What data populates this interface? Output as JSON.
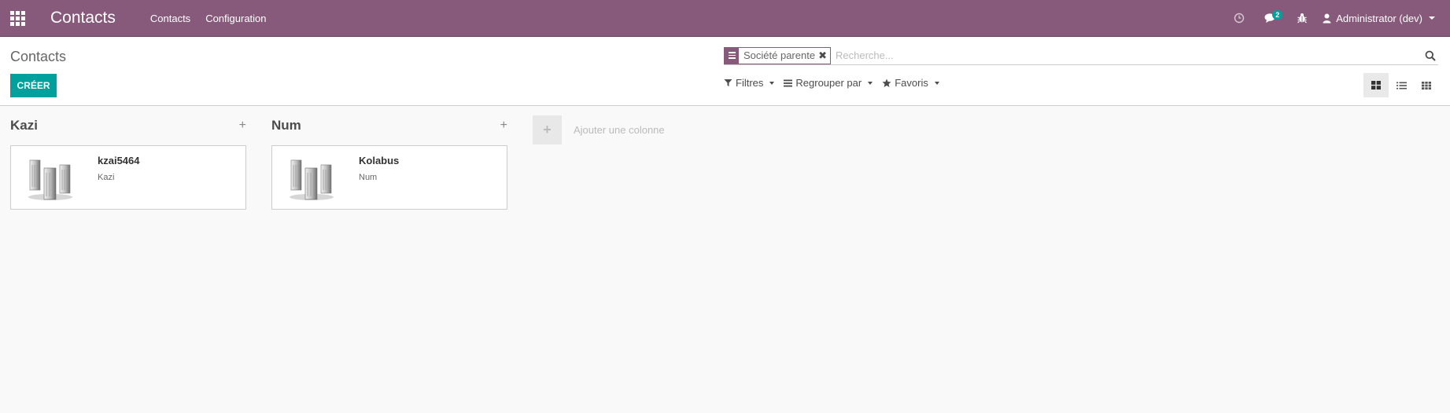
{
  "navbar": {
    "brand": "Contacts",
    "menu": [
      "Contacts",
      "Configuration"
    ],
    "messages_badge": "2",
    "user_label": "Administrator (dev)",
    "colors": {
      "bar": "#875a7b",
      "badge": "#00a09d"
    },
    "icons": [
      "apps-grid-icon",
      "clock-icon",
      "chat-icon",
      "bug-icon",
      "user-icon"
    ]
  },
  "control_panel": {
    "breadcrumb": "Contacts",
    "create_label": "CRÉER",
    "search": {
      "facet": "Société parente",
      "placeholder": "Recherche..."
    },
    "filters": {
      "filters_label": "Filtres",
      "groupby_label": "Regrouper par",
      "favorites_label": "Favoris"
    },
    "views": [
      "kanban-view-icon",
      "list-view-icon",
      "grid-view-icon"
    ]
  },
  "kanban": {
    "columns": [
      {
        "title": "Kazi",
        "cards": [
          {
            "name": "kzai5464",
            "company": "Kazi"
          }
        ]
      },
      {
        "title": "Num",
        "cards": [
          {
            "name": "Kolabus",
            "company": "Num"
          }
        ]
      }
    ],
    "add_column_label": "Ajouter une colonne"
  }
}
